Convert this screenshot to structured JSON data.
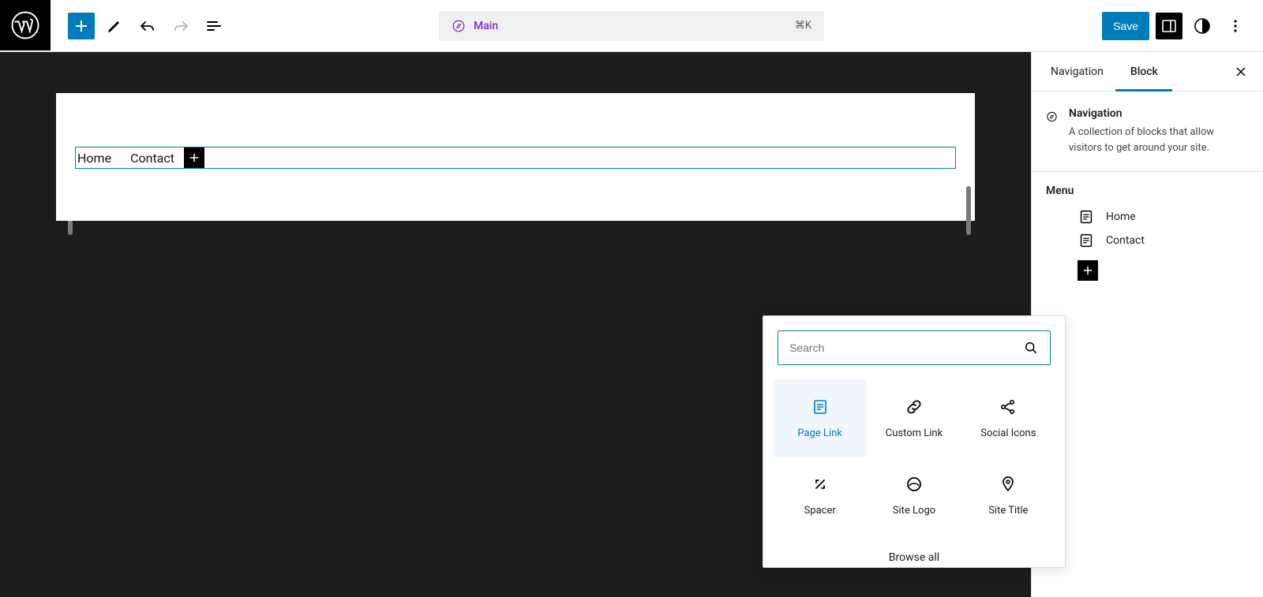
{
  "top": {
    "template_name": "Main",
    "command_hint": "⌘K",
    "save_label": "Save"
  },
  "nav_block": {
    "items": [
      "Home",
      "Contact"
    ]
  },
  "sidebar": {
    "tabs": {
      "navigation": "Navigation",
      "block": "Block"
    },
    "block_info": {
      "title": "Navigation",
      "description": "A collection of blocks that allow visitors to get around your site."
    },
    "menu": {
      "title": "Menu",
      "items": [
        "Home",
        "Contact"
      ]
    }
  },
  "popover": {
    "search_placeholder": "Search",
    "items": [
      {
        "label": "Page Link",
        "icon": "page-icon",
        "selected": true
      },
      {
        "label": "Custom Link",
        "icon": "link-icon",
        "selected": false
      },
      {
        "label": "Social Icons",
        "icon": "share-icon",
        "selected": false
      },
      {
        "label": "Spacer",
        "icon": "resize-icon",
        "selected": false
      },
      {
        "label": "Site Logo",
        "icon": "circle-logo-icon",
        "selected": false
      },
      {
        "label": "Site Title",
        "icon": "pin-icon",
        "selected": false
      }
    ],
    "browse_all": "Browse all"
  }
}
